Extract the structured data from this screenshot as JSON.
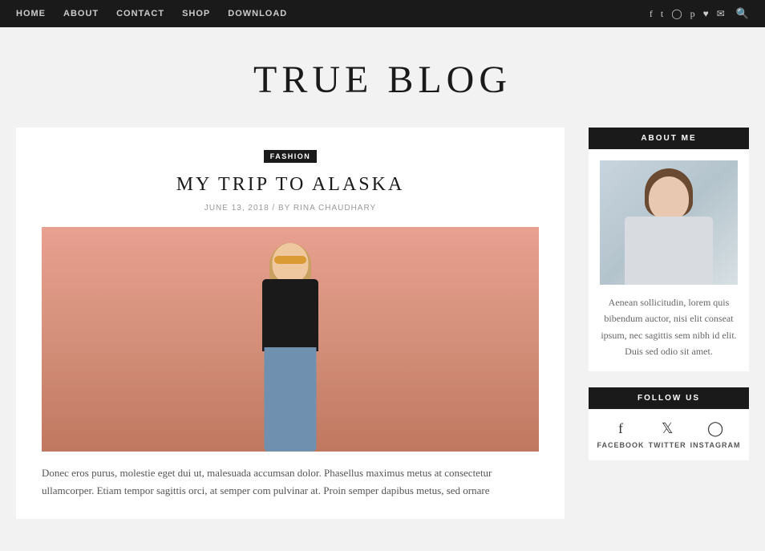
{
  "nav": {
    "links": [
      {
        "label": "HOME",
        "href": "#"
      },
      {
        "label": "ABOUT",
        "href": "#"
      },
      {
        "label": "CONTACT",
        "href": "#"
      },
      {
        "label": "SHOP",
        "href": "#"
      },
      {
        "label": "DOWNLOAD",
        "href": "#"
      }
    ],
    "social_icons": [
      "f",
      "t",
      "ig",
      "p",
      "♥",
      "✉"
    ],
    "search_icon": "🔍"
  },
  "site": {
    "title": "TRUE BLOG"
  },
  "post": {
    "category": "FASHION",
    "title": "MY TRIP TO ALASKA",
    "date": "JUNE 13, 2018",
    "author": "RINA CHAUDHARY",
    "meta": "JUNE 13, 2018 / BY RINA CHAUDHARY",
    "excerpt": "Donec eros purus, molestie eget dui ut, malesuada accumsan dolor. Phasellus maximus metus at consectetur ullamcorper. Etiam tempor sagittis orci, at semper com pulvinar at. Proin semper dapibus metus, sed ornare"
  },
  "sidebar": {
    "about": {
      "header": "ABOUT ME",
      "text": "Aenean sollicitudin, lorem quis bibendum auctor, nisi elit conseat ipsum, nec sagittis sem nibh id elit. Duis sed odio sit amet."
    },
    "follow": {
      "header": "FOLLOW US",
      "platforms": [
        {
          "label": "FACEBOOK",
          "icon": "f"
        },
        {
          "label": "TWITTER",
          "icon": "t"
        },
        {
          "label": "INSTAGRAM",
          "icon": "ig"
        }
      ]
    }
  }
}
